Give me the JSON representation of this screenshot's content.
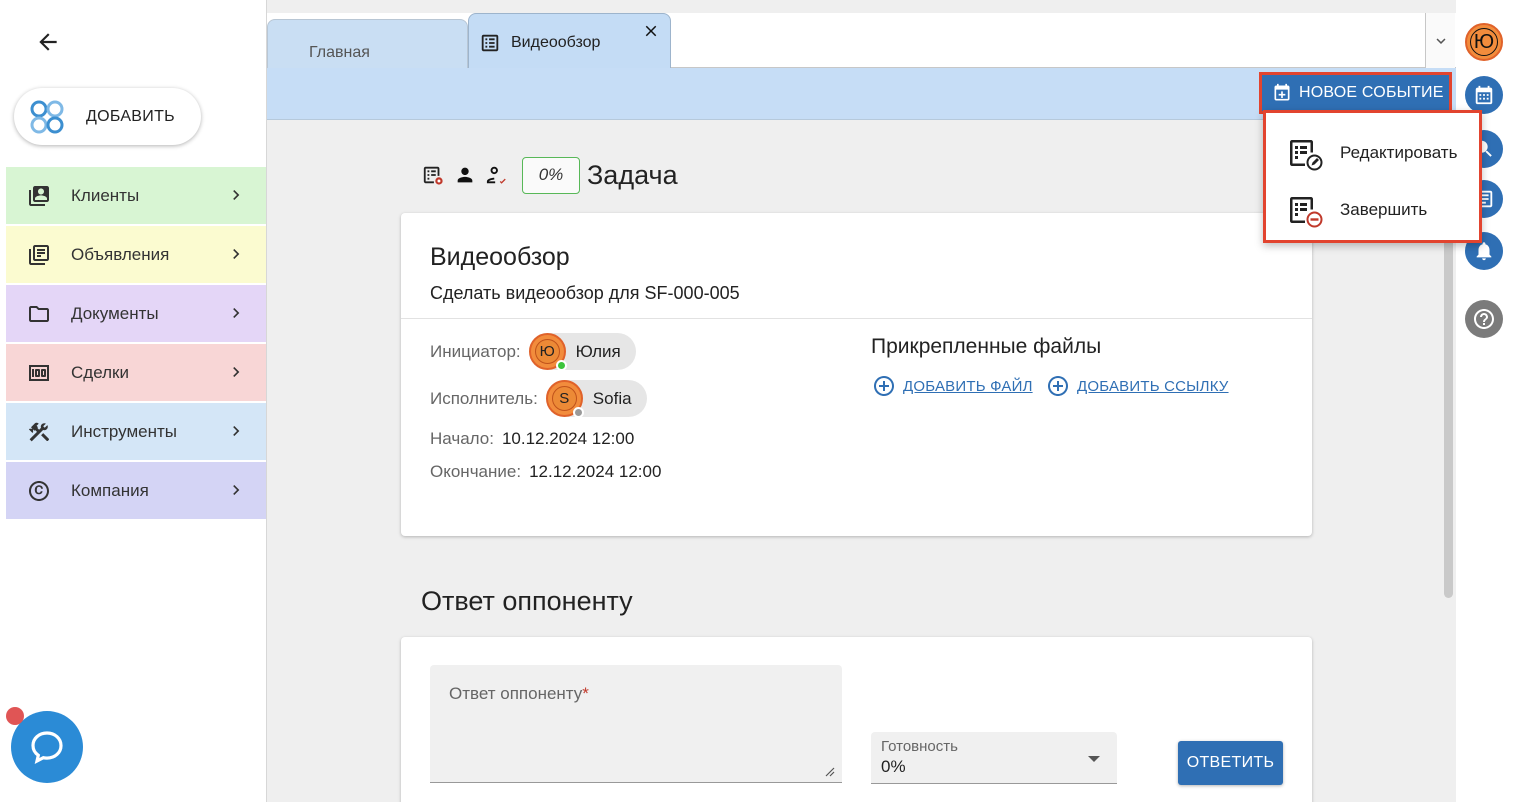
{
  "sidebar": {
    "add_label": "ДОБАВИТЬ",
    "items": [
      {
        "label": "Клиенты",
        "icon": "contacts-icon",
        "bg": "#d8f5d3"
      },
      {
        "label": "Объявления",
        "icon": "listing-icon",
        "bg": "#fbfbd0"
      },
      {
        "label": "Документы",
        "icon": "folder-icon",
        "bg": "#e4d6f7"
      },
      {
        "label": "Сделки",
        "icon": "money-icon",
        "bg": "#f8d6d6"
      },
      {
        "label": "Инструменты",
        "icon": "tools-icon",
        "bg": "#d4e6f7"
      },
      {
        "label": "Компания",
        "icon": "copyright-icon",
        "bg": "#d4d4f5"
      }
    ]
  },
  "tabs": {
    "home": "Главная",
    "active": "Видеообзор"
  },
  "toolbar": {
    "new_event": "НОВОЕ СОБЫТИЕ"
  },
  "menu": {
    "edit": "Редактировать",
    "finish": "Завершить"
  },
  "task": {
    "progress": "0%",
    "type": "Задача",
    "title": "Видеообзор",
    "description": "Сделать видеообзор для SF-000-005",
    "initiator_label": "Инициатор:",
    "initiator_initial": "Ю",
    "initiator_name": "Юлия",
    "executor_label": "Исполнитель:",
    "executor_initial": "S",
    "executor_name": "Sofia",
    "start_label": "Начало:",
    "start_value": "10.12.2024 12:00",
    "end_label": "Окончание:",
    "end_value": "12.12.2024 12:00",
    "attachments_title": "Прикрепленные файлы",
    "add_file": "ДОБАВИТЬ ФАЙЛ",
    "add_link": "ДОБАВИТЬ ССЫЛКУ"
  },
  "reply": {
    "section_title": "Ответ оппоненту",
    "placeholder": "Ответ оппоненту",
    "required_mark": "*",
    "readiness_label": "Готовность",
    "readiness_value": "0%",
    "submit": "ОТВЕТИТЬ"
  },
  "rail": {
    "user_initial": "Ю"
  },
  "colors": {
    "accent": "#2f6fb4",
    "highlight": "#e2442f",
    "toolbar_bg": "#c6ddf6"
  }
}
